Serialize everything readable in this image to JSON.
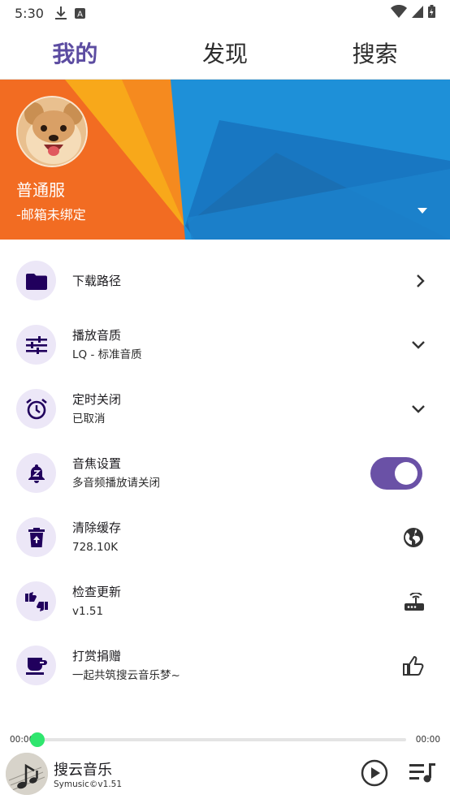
{
  "status_bar": {
    "time": "5:30"
  },
  "tabs": [
    {
      "label": "我的",
      "active": true
    },
    {
      "label": "发现",
      "active": false
    },
    {
      "label": "搜索",
      "active": false
    }
  ],
  "profile": {
    "username": "普通服",
    "email": "-邮箱未绑定"
  },
  "settings": [
    {
      "title": "下载路径",
      "subtitle": "",
      "icon": "folder-icon",
      "trailing": "chevron-right-icon"
    },
    {
      "title": "播放音质",
      "subtitle": "LQ - 标准音质",
      "icon": "tune-icon",
      "trailing": "chevron-down-icon"
    },
    {
      "title": "定时关闭",
      "subtitle": "已取消",
      "icon": "alarm-icon",
      "trailing": "chevron-down-icon"
    },
    {
      "title": "音焦设置",
      "subtitle": "多音频播放请关闭",
      "icon": "snooze-bell-icon",
      "trailing": "toggle",
      "toggle_on": true
    },
    {
      "title": "清除缓存",
      "subtitle": "728.10K",
      "icon": "delete-icon",
      "trailing": "globe-icon"
    },
    {
      "title": "检查更新",
      "subtitle": "v1.51",
      "icon": "thumbs-up-down-icon",
      "trailing": "router-icon"
    },
    {
      "title": "打赏捐赠",
      "subtitle": "一起共筑搜云音乐梦~",
      "icon": "coffee-icon",
      "trailing": "thumb-up-icon"
    }
  ],
  "player": {
    "current_time": "00:00",
    "total_time": "00:00",
    "progress": 0,
    "title": "搜云音乐",
    "subtitle": "Symusic©v1.51"
  },
  "colors": {
    "accent": "#5c4ca1",
    "icon_bg": "#ece7f7",
    "icon_fg": "#21005d",
    "toggle_on": "#6a51a6",
    "progress_thumb": "#2fe66e",
    "banner_orange": "#f26c22",
    "banner_blue": "#1e90d8"
  }
}
